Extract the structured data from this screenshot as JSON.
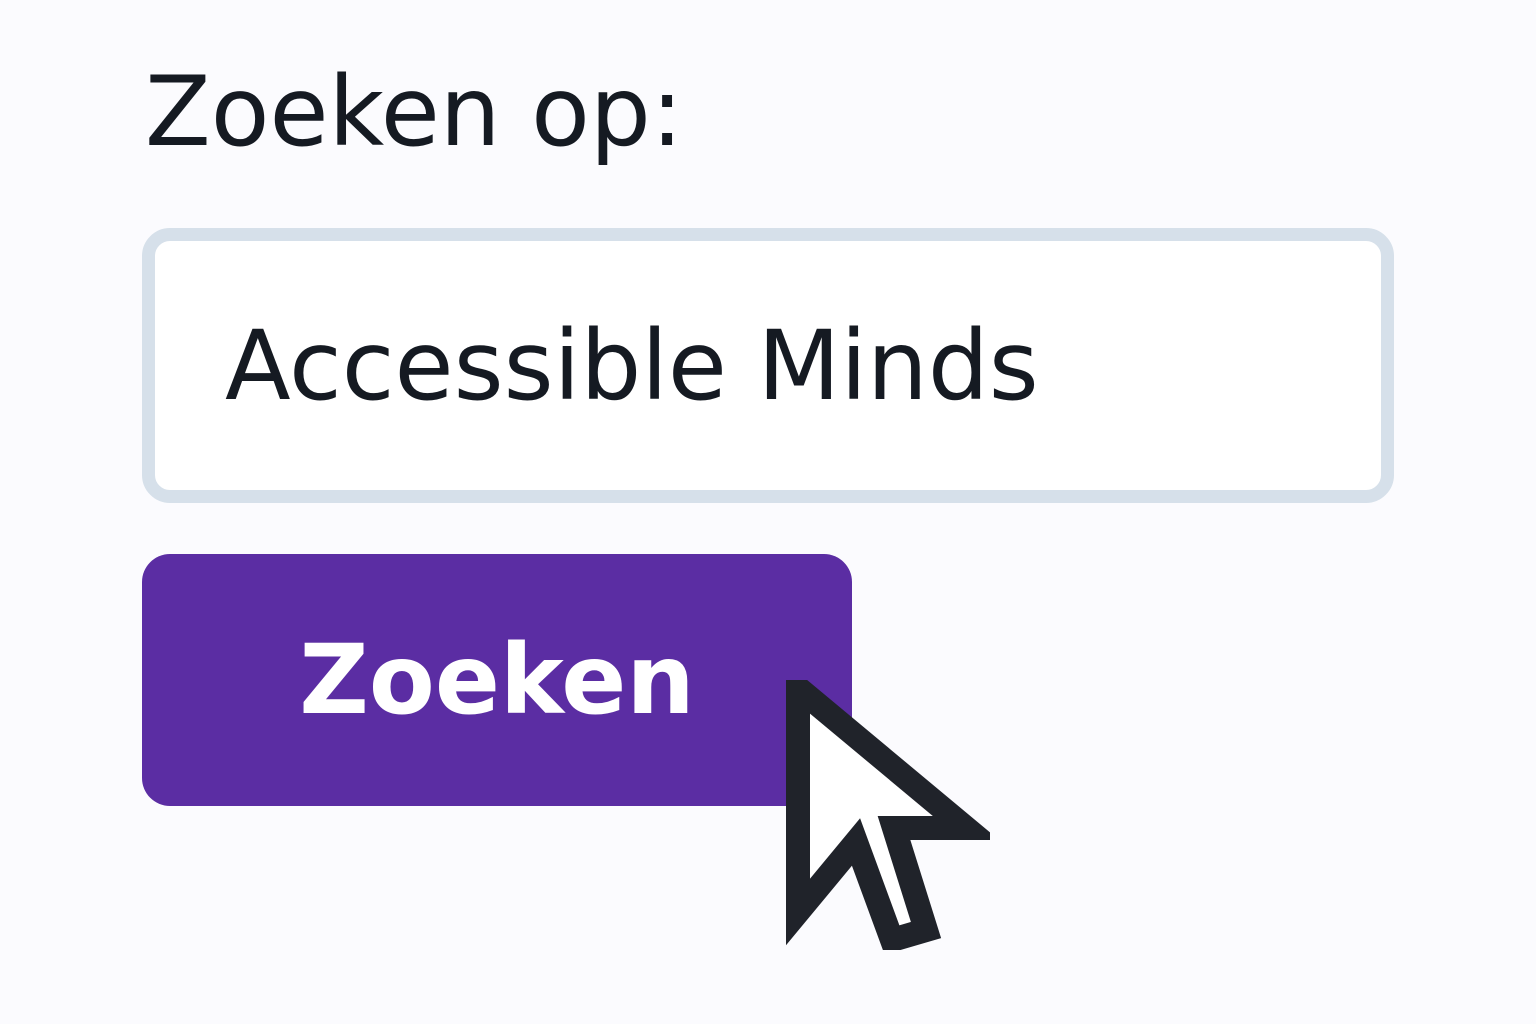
{
  "form": {
    "label": "Zoeken op:",
    "input_value": "Accessible Minds",
    "button_label": "Zoeken"
  },
  "colors": {
    "background": "#fbfbfe",
    "text": "#151a22",
    "input_border": "#d6e0ea",
    "button_bg": "#5b2da3",
    "button_text": "#ffffff",
    "cursor": "#20232a"
  },
  "icons": {
    "cursor": "mouse-pointer-icon"
  }
}
